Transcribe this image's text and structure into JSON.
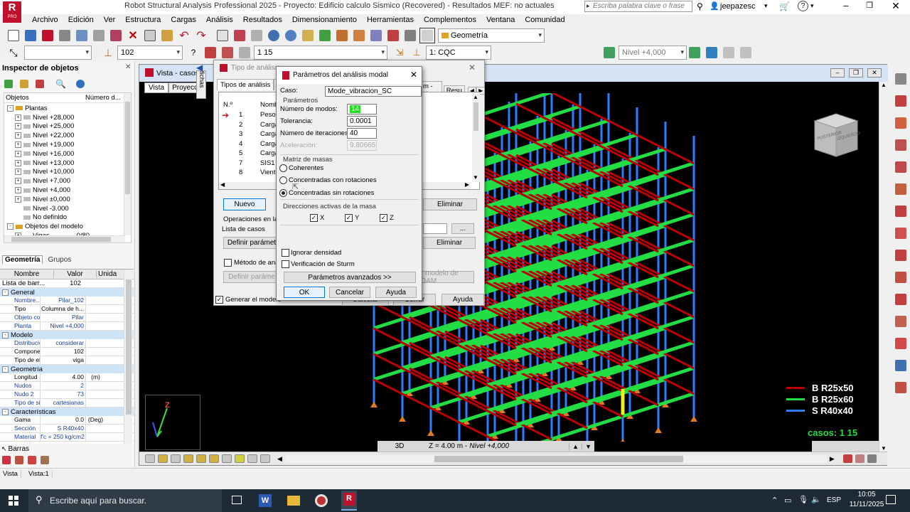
{
  "window": {
    "title": "Robot Structural Analysis Professional 2025 - Proyecto: Edificio calculo Sismico (Recovered) - Resultados MEF: no actuales",
    "search_placeholder": "Escriba palabra clave o frase",
    "user": "jeepazesc",
    "logo_letter": "R",
    "logo_sub": "PRO"
  },
  "menu": [
    "Archivo",
    "Edición",
    "Ver",
    "Estructura",
    "Cargas",
    "Análisis",
    "Resultados",
    "Dimensionamiento",
    "Herramientas",
    "Complementos",
    "Ventana",
    "Comunidad"
  ],
  "toolbar": {
    "layout_combo": "Geometría",
    "section_combo": "102",
    "cases_combo": "1 15",
    "case_combo": "1: CQC",
    "level_combo": "Nivel +4,000"
  },
  "inspector": {
    "title": "Inspector de objetos",
    "col_objects": "Objetos",
    "col_number": "Número d...",
    "tree": [
      {
        "label": "Plantas",
        "level": 1,
        "exp": "-"
      },
      {
        "label": "Nivel +28,000",
        "level": 2,
        "exp": "+"
      },
      {
        "label": "Nivel +25,000",
        "level": 2,
        "exp": "+"
      },
      {
        "label": "Nivel +22,000",
        "level": 2,
        "exp": "+"
      },
      {
        "label": "Nivel +19,000",
        "level": 2,
        "exp": "+"
      },
      {
        "label": "Nivel +16,000",
        "level": 2,
        "exp": "+"
      },
      {
        "label": "Nivel +13,000",
        "level": 2,
        "exp": "+"
      },
      {
        "label": "Nivel +10,000",
        "level": 2,
        "exp": "+"
      },
      {
        "label": "Nivel +7,000",
        "level": 2,
        "exp": "+"
      },
      {
        "label": "Nivel +4,000",
        "level": 2,
        "exp": "+"
      },
      {
        "label": "Nivel ±0,000",
        "level": 2,
        "exp": "+"
      },
      {
        "label": "Nivel -3.000",
        "level": 2,
        "exp": ""
      },
      {
        "label": "No definido",
        "level": 2,
        "exp": ""
      },
      {
        "label": "Objetos del modelo",
        "level": 1,
        "exp": "-"
      },
      {
        "label": "Vigas",
        "level": 2,
        "exp": "+",
        "count": "0/80"
      }
    ],
    "tabs": [
      "Geometría",
      "Grupos"
    ]
  },
  "props": {
    "headers": [
      "Nombre",
      "Valor",
      "Unida"
    ],
    "list_label": "Lista de barr...",
    "list_value": "102",
    "sections": [
      {
        "title": "General",
        "rows": [
          {
            "n": "Nombre...",
            "v": "Pilar_102",
            "u": "",
            "blue": true
          },
          {
            "n": "Tipo",
            "v": "Columna de h...",
            "u": ""
          },
          {
            "n": "Objeto co...",
            "v": "Pilar",
            "u": "",
            "blue": true
          },
          {
            "n": "Planta",
            "v": "Nivel +4,000",
            "u": "",
            "blue": true
          }
        ]
      },
      {
        "title": "Modelo",
        "rows": [
          {
            "n": "Distribució...",
            "v": "considerar",
            "u": "",
            "blue": true
          },
          {
            "n": "Compone...",
            "v": "102",
            "u": ""
          },
          {
            "n": "Tipo de el...",
            "v": "viga",
            "u": ""
          }
        ]
      },
      {
        "title": "Geometría",
        "rows": [
          {
            "n": "Longitud",
            "v": "4.00",
            "u": "(m)"
          },
          {
            "n": "Nudos",
            "v": "2",
            "u": "",
            "blue": true
          },
          {
            "n": "Nudo 2",
            "v": "73",
            "u": "",
            "blue": true
          },
          {
            "n": "Tipo de si...",
            "v": "cartesianas",
            "u": "",
            "blue": true
          }
        ]
      },
      {
        "title": "Características",
        "rows": [
          {
            "n": "Gama",
            "v": "0.0",
            "u": "(Deg)"
          },
          {
            "n": "Sección",
            "v": "S R40x40",
            "u": "",
            "blue": true
          },
          {
            "n": "Material",
            "v": "f'c = 250 kg/cm2",
            "u": "",
            "blue": true
          }
        ]
      }
    ],
    "bottom_tab": "Barras"
  },
  "view_window": {
    "title": "Vista - casos:",
    "tabs": [
      "Vista",
      "Proyecci"
    ],
    "status_3d": "3D",
    "status_z": "Z = 4.00 m - ",
    "status_level": "Nivel +4,000",
    "viewcube_left": "POSTERIOR",
    "viewcube_right": "IZQUIERDO",
    "legend": [
      {
        "label": "B R25x50",
        "color": "#b80000"
      },
      {
        "label": "B R25x60",
        "color": "#22dd44"
      },
      {
        "label": "S R40x40",
        "color": "#2f7dff"
      }
    ],
    "cases_label": "casos: 1 15",
    "axis_z": "Z",
    "side_label": "fichas"
  },
  "analysis_type_dialog": {
    "title": "Tipo de análisis",
    "tabs": [
      "Tipos de análisis",
      "Es"
    ],
    "right_tabs": [
      "m - signo",
      "Resu"
    ],
    "col_no": "N.º",
    "col_name": "Nombr",
    "rows": [
      {
        "no": "1",
        "name": "Peso p"
      },
      {
        "no": "2",
        "name": "Carga"
      },
      {
        "no": "3",
        "name": "Carga"
      },
      {
        "no": "4",
        "name": "Carga"
      },
      {
        "no": "5",
        "name": "Carga"
      },
      {
        "no": "7",
        "name": "SIS1"
      },
      {
        "no": "8",
        "name": "Viento"
      }
    ],
    "btn_nuevo": "Nuevo",
    "btn_eliminar": "Eliminar",
    "ops_label": "Operaciones en la s",
    "cases_list": "Lista de casos",
    "btn_define_params": "Definir parámet",
    "btn_eliminar2": "Eliminar",
    "metodo": "Método de anál",
    "btn_define_params2": "Definir paráme",
    "btn_dam": "r modelo de DAM",
    "generate": "Generar el modelo",
    "btn_calc": "Calcular",
    "btn_close": "Cerrar",
    "btn_help": "Ayuda",
    "ellipsis": "..."
  },
  "modal_dialog": {
    "title": "Parámetros del análisis modal",
    "case_label": "Caso:",
    "case_value": "Mode_vibracion_SC",
    "params_title": "Parámetros",
    "modes_label": "Número de modos:",
    "modes_value": "14",
    "tol_label": "Tolerancia:",
    "tol_value": "0.0001",
    "iter_label": "Número de iteraciones:",
    "iter_value": "40",
    "accel_label": "Aceleración:",
    "accel_value": "9.80665",
    "mass_title": "Matriz de masas",
    "radio_coherent": "Coherentes",
    "radio_conc_rot": "Concentradas con rotaciones",
    "radio_conc_norot": "Concentradas sin rotaciones",
    "dir_title": "Direcciones activas de la masa",
    "dir_x": "X",
    "dir_y": "Y",
    "dir_z": "Z",
    "ignore_density": "Ignorar densidad",
    "sturm": "Verificación de Sturm",
    "advanced": "Parámetros avanzados >>",
    "ok": "OK",
    "cancel": "Cancelar",
    "help": "Ayuda"
  },
  "statusbar": {
    "tab1": "Vista",
    "tab2": "Vista:1"
  },
  "taskbar": {
    "search": "Escribe aquí para buscar.",
    "lang": "ESP",
    "time": "10:05",
    "date": "11/11/2025"
  }
}
